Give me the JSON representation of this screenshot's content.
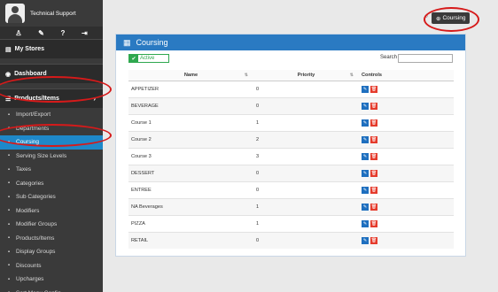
{
  "sidebar": {
    "user": "Technical Support",
    "toolbar_icons": [
      "user-icon",
      "wrench-icon",
      "help-icon",
      "logout-icon"
    ],
    "sections": {
      "stores": "My Stores",
      "dashboard": "Dashboard",
      "products": "Products/Items"
    },
    "items": [
      {
        "label": "Import/Export",
        "icon": "import-icon"
      },
      {
        "label": "Departments",
        "icon": "departments-icon"
      },
      {
        "label": "Coursing",
        "icon": "coursing-icon",
        "active": true
      },
      {
        "label": "Serving Size Levels",
        "icon": "serving-size-icon"
      },
      {
        "label": "Taxes",
        "icon": "taxes-icon"
      },
      {
        "label": "Categories",
        "icon": "categories-icon"
      },
      {
        "label": "Sub Categories",
        "icon": "sub-categories-icon"
      },
      {
        "label": "Modifiers",
        "icon": "modifiers-icon"
      },
      {
        "label": "Modifier Groups",
        "icon": "modifier-groups-icon"
      },
      {
        "label": "Products/Items",
        "icon": "products-icon"
      },
      {
        "label": "Display Groups",
        "icon": "display-groups-icon"
      },
      {
        "label": "Discounts",
        "icon": "discounts-icon"
      },
      {
        "label": "Upcharges",
        "icon": "upcharges-icon"
      },
      {
        "label": "Sort Menu Config",
        "icon": "sort-menu-icon"
      }
    ]
  },
  "top": {
    "button_label": "Coursing"
  },
  "panel": {
    "title": "Coursing",
    "active_label": "Active",
    "search_label": "Search",
    "search_value": ""
  },
  "table": {
    "headers": [
      "Name",
      "Priority",
      "Controls"
    ],
    "rows": [
      {
        "name": "APPETIZER",
        "priority": "0"
      },
      {
        "name": "BEVERAGE",
        "priority": "0"
      },
      {
        "name": "Course 1",
        "priority": "1"
      },
      {
        "name": "Course 2",
        "priority": "2"
      },
      {
        "name": "Course 3",
        "priority": "3"
      },
      {
        "name": "DESSERT",
        "priority": "0"
      },
      {
        "name": "ENTREE",
        "priority": "0"
      },
      {
        "name": "NA Beverages",
        "priority": "1"
      },
      {
        "name": "PIZZA",
        "priority": "1"
      },
      {
        "name": "RETAIL",
        "priority": "0"
      }
    ]
  },
  "colors": {
    "accent": "#2a7ac2",
    "active_nav": "#1e88c9",
    "annotation": "#d61a1a",
    "edit": "#1e6fbf",
    "delete": "#e53b2c"
  }
}
